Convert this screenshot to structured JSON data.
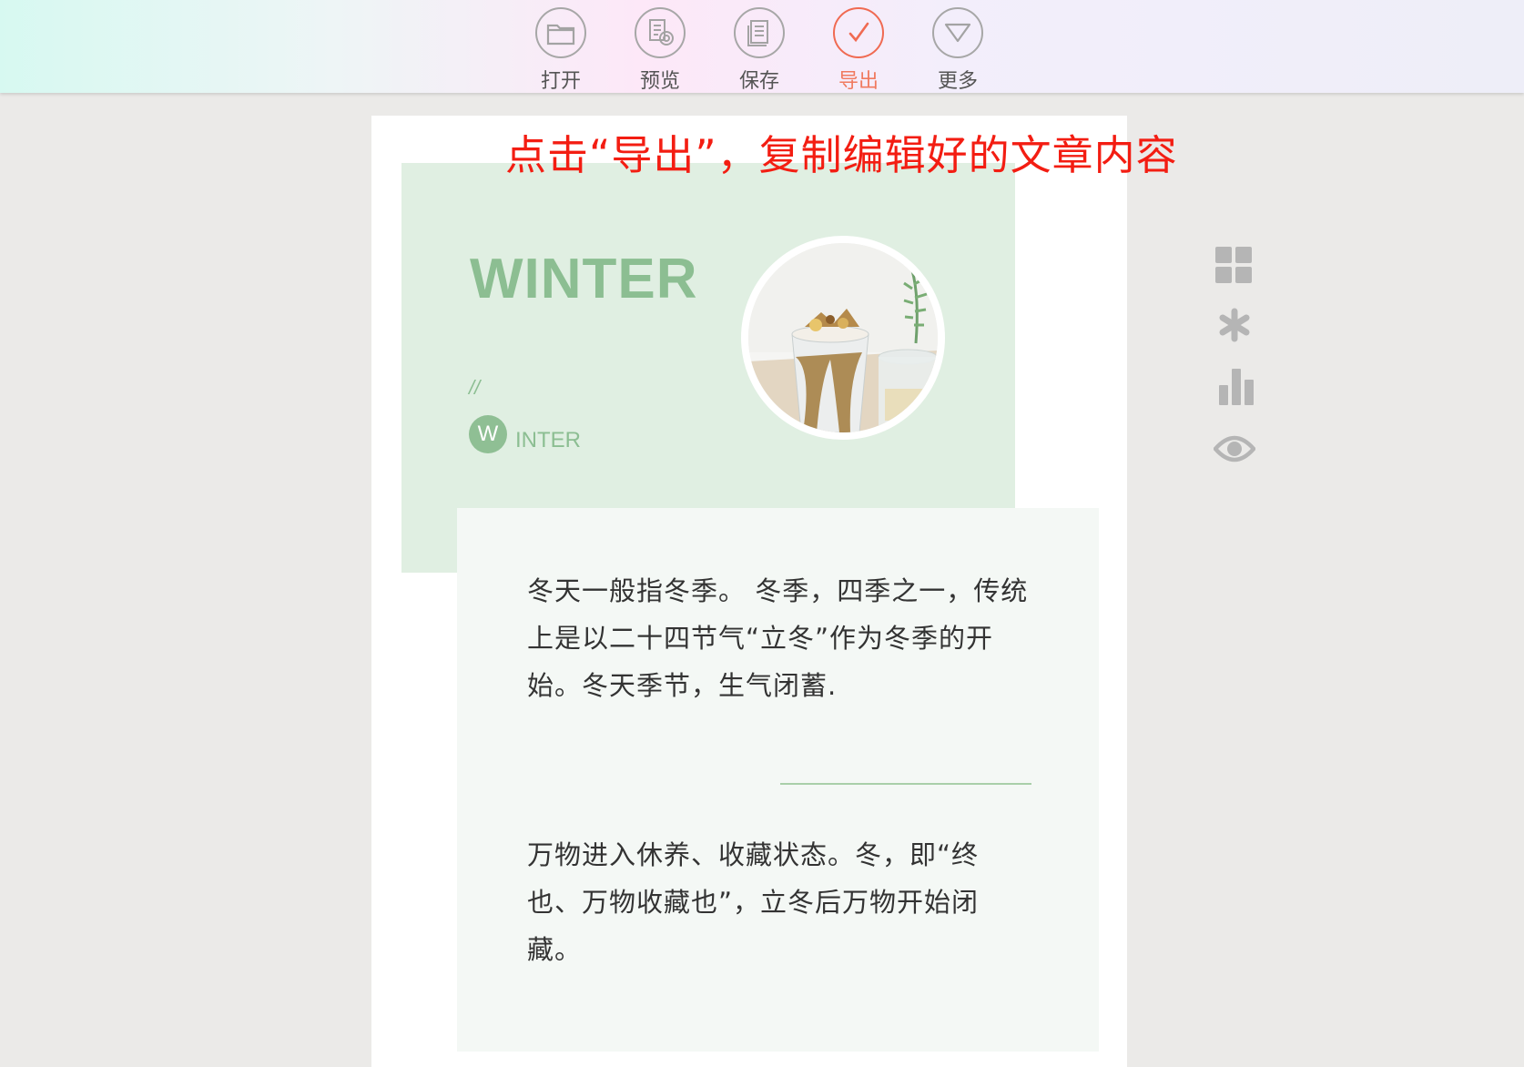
{
  "toolbar": {
    "items": [
      {
        "label": "打开",
        "icon": "folder-icon"
      },
      {
        "label": "预览",
        "icon": "preview-icon"
      },
      {
        "label": "保存",
        "icon": "save-icon"
      },
      {
        "label": "导出",
        "icon": "checkmark-icon",
        "active": true
      },
      {
        "label": "更多",
        "icon": "triangle-down-icon"
      }
    ],
    "active_color": "#f06a52"
  },
  "annotation": "点击“导出”，复制编辑好的文章内容",
  "article": {
    "cover_title": "WINTER",
    "cover_slash": "//",
    "badge_letter": "W",
    "badge_text": "INTER",
    "cover_image": "iced-coffee-photo",
    "paragraph1": "冬天一般指冬季。 冬季，四季之一，传统上是以二十四节气“立冬”作为冬季的开始。冬天季节，生气闭蓄.",
    "paragraph2": "万物进入休养、收藏状态。冬，即“终也、万物收藏也”，立冬后万物开始闭藏。",
    "accent_color": "#8cbe92"
  },
  "side_icons": [
    "grid-icon",
    "asterisk-icon",
    "bar-chart-icon",
    "eye-icon"
  ]
}
